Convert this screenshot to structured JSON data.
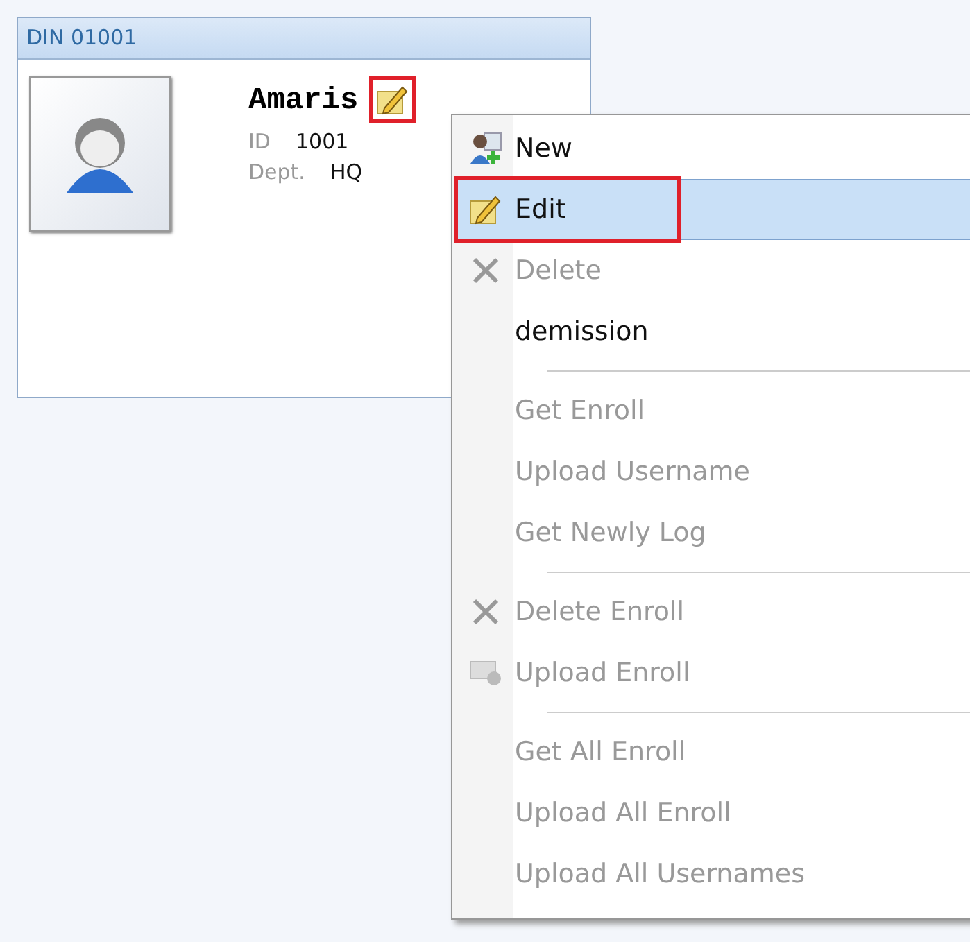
{
  "card": {
    "title": "DIN 01001",
    "name": "Amaris",
    "edit_icon_annotated": true,
    "fields": [
      {
        "label": "ID",
        "value": "1001"
      },
      {
        "label": "Dept.",
        "value": "HQ"
      }
    ]
  },
  "context_menu": {
    "items": [
      {
        "kind": "item",
        "label": "New",
        "disabled": false,
        "selected": false,
        "annotated": false
      },
      {
        "kind": "item",
        "label": "Edit",
        "disabled": false,
        "selected": true,
        "annotated": true
      },
      {
        "kind": "item",
        "label": "Delete",
        "disabled": true,
        "selected": false,
        "annotated": false
      },
      {
        "kind": "item",
        "label": "demission",
        "disabled": false,
        "selected": false,
        "annotated": false
      },
      {
        "kind": "separator"
      },
      {
        "kind": "item",
        "label": "Get Enroll",
        "disabled": true,
        "selected": false,
        "annotated": false
      },
      {
        "kind": "item",
        "label": "Upload Username",
        "disabled": true,
        "selected": false,
        "annotated": false
      },
      {
        "kind": "item",
        "label": "Get Newly Log",
        "disabled": true,
        "selected": false,
        "annotated": false
      },
      {
        "kind": "separator"
      },
      {
        "kind": "item",
        "label": "Delete Enroll",
        "disabled": true,
        "selected": false,
        "annotated": false
      },
      {
        "kind": "item",
        "label": "Upload Enroll",
        "disabled": true,
        "selected": false,
        "annotated": false
      },
      {
        "kind": "separator"
      },
      {
        "kind": "item",
        "label": "Get All Enroll",
        "disabled": true,
        "selected": false,
        "annotated": false
      },
      {
        "kind": "item",
        "label": "Upload All Enroll",
        "disabled": true,
        "selected": false,
        "annotated": false
      },
      {
        "kind": "item",
        "label": "Upload All Usernames",
        "disabled": true,
        "selected": false,
        "annotated": false
      }
    ]
  }
}
